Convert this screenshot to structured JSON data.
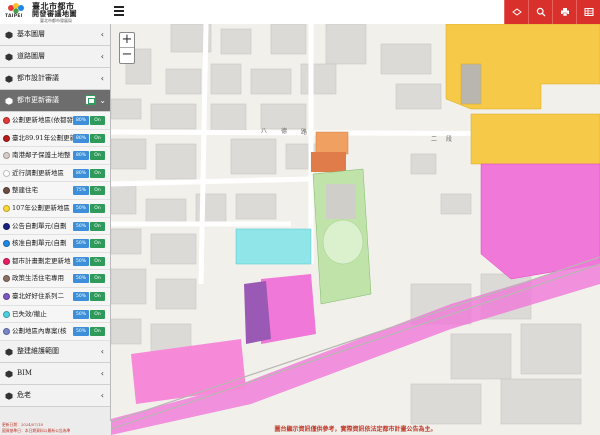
{
  "header": {
    "logo_caption": "TAIPEI",
    "title_line1": "臺北市都市",
    "title_line2": "開發審議地圖",
    "subtitle": "臺北市都市發展局",
    "toolbar_icons": [
      "layers-icon",
      "search-icon",
      "print-icon",
      "grid-icon"
    ],
    "toolbar_color": "#d9302c"
  },
  "sidebar": {
    "categories_top": [
      {
        "label": "基本圖層"
      },
      {
        "label": "道路圖層"
      },
      {
        "label": "都市設計審議"
      }
    ],
    "active_category": {
      "label": "都市更新審議"
    },
    "layers": [
      {
        "name": "公劃更新地區(依都發局",
        "color": "#e53935",
        "opacity": "80%",
        "toggle": "On"
      },
      {
        "name": "臺北89.91年公劃更新",
        "color": "#b71c1c",
        "opacity": "80%",
        "toggle": "On"
      },
      {
        "name": "南港鄰子保護土地整",
        "color": "#d7ccc8",
        "opacity": "80%",
        "toggle": "On"
      },
      {
        "name": "近行調劃更新地區",
        "color": "#ffffff",
        "opacity": "80%",
        "toggle": "On"
      },
      {
        "name": "整建住宅",
        "color": "#6d4c41",
        "opacity": "75%",
        "toggle": "On"
      },
      {
        "name": "107年公劃更新地區",
        "color": "#fdd835",
        "opacity": "50%",
        "toggle": "On"
      },
      {
        "name": "公告自劃單元(自劃",
        "color": "#1a237e",
        "opacity": "50%",
        "toggle": "On"
      },
      {
        "name": "核准自劃單元(自劃",
        "color": "#1e88e5",
        "opacity": "50%",
        "toggle": "On"
      },
      {
        "name": "都市計畫劃定更新地",
        "color": "#e91e63",
        "opacity": "50%",
        "toggle": "On"
      },
      {
        "name": "政策生活住宅專用",
        "color": "#8d6e63",
        "opacity": "50%",
        "toggle": "On"
      },
      {
        "name": "臺北好好住系列二",
        "color": "#7e57c2",
        "opacity": "50%",
        "toggle": "On"
      },
      {
        "name": "已失效/撤止",
        "color": "#4dd0e1",
        "opacity": "50%",
        "toggle": "On"
      },
      {
        "name": "公劃地區內專案(核",
        "color": "#7986cb",
        "opacity": "50%",
        "toggle": "On"
      }
    ],
    "categories_bottom": [
      {
        "label": "整建維護範圍"
      },
      {
        "label": "BIM"
      },
      {
        "label": "危老"
      }
    ],
    "footer_line1": "更新日期：2024/07/18",
    "footer_line2": "圖資基準日：本日期資料以最新公告為準"
  },
  "map": {
    "zoom_in": "+",
    "zoom_out": "−",
    "road_labels": [
      "八",
      "德",
      "路",
      "二",
      "段"
    ],
    "disclaimer": "圖台顯示資訊僅供參考，實際資訊依法定都市計畫公告為主。"
  }
}
